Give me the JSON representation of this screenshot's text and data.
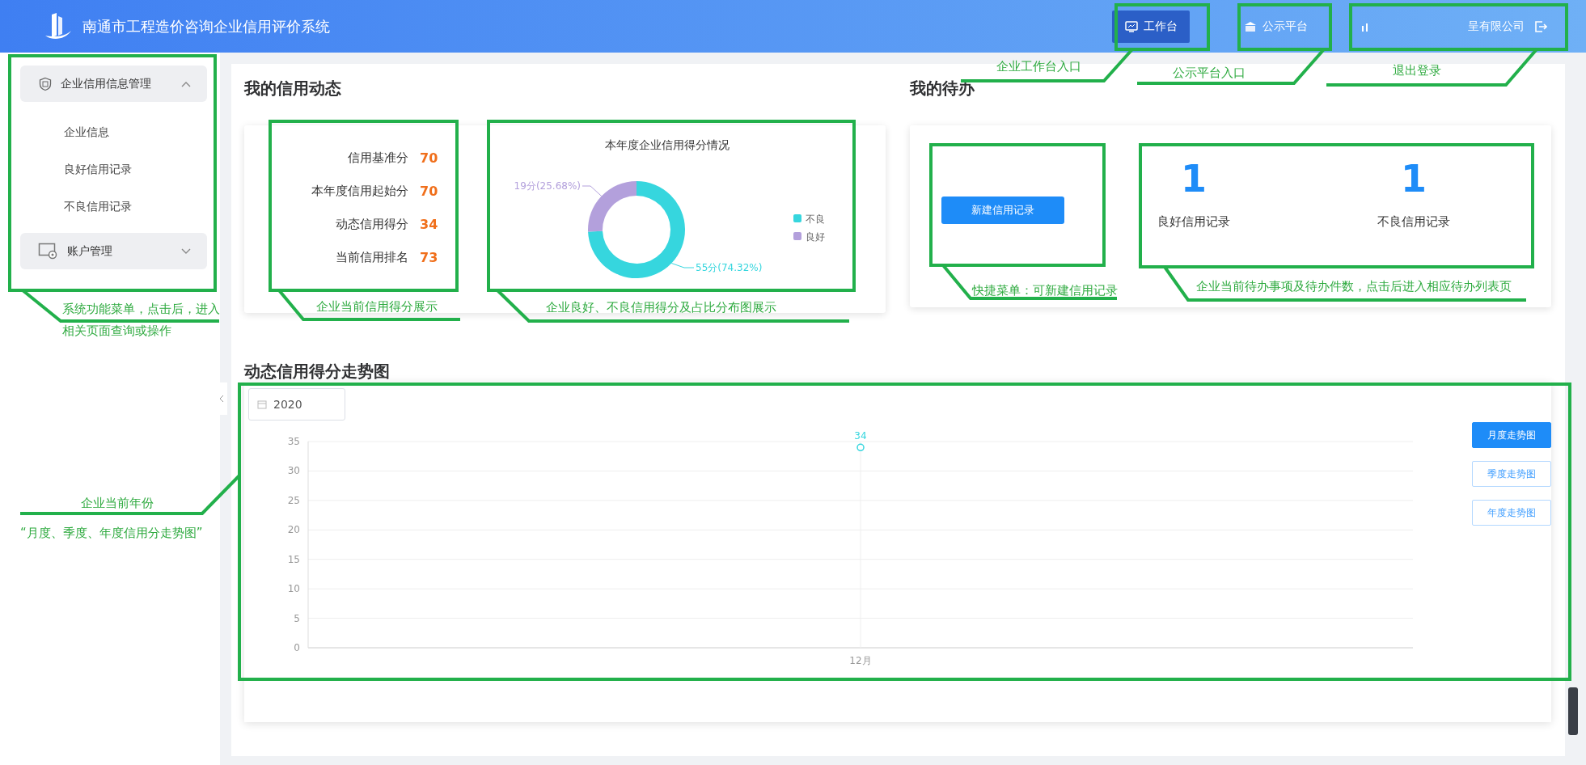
{
  "header": {
    "title": "南通市工程造价咨询企业信用评价系统",
    "nav": [
      {
        "label": "工作台",
        "selected": true
      },
      {
        "label": "公示平台",
        "selected": false
      }
    ],
    "user": {
      "name": "呈有限公司"
    }
  },
  "sidebar": {
    "groups": [
      {
        "label": "企业信用信息管理",
        "expanded": true,
        "items": [
          "企业信息",
          "良好信用记录",
          "不良信用记录"
        ]
      },
      {
        "label": "账户管理",
        "expanded": false
      }
    ]
  },
  "credit": {
    "title": "我的信用动态",
    "scores": [
      {
        "label": "信用基准分",
        "value": "70"
      },
      {
        "label": "本年度信用起始分",
        "value": "70"
      },
      {
        "label": "动态信用得分",
        "value": "34"
      },
      {
        "label": "当前信用排名",
        "value": "73"
      }
    ],
    "pie": {
      "chart_data": {
        "type": "donut",
        "title": "本年度企业信用得分情况",
        "categories": [
          "不良",
          "良好"
        ],
        "values": [
          55,
          19
        ],
        "colors": [
          "#36d6de",
          "#b3a0dc"
        ],
        "value_labels": [
          "55分(74.32%)",
          "19分(25.68%)"
        ],
        "legend": true
      }
    }
  },
  "todo": {
    "title": "我的待办",
    "action": "新建信用记录",
    "counts": [
      {
        "value": "1",
        "label": "良好信用记录"
      },
      {
        "value": "1",
        "label": "不良信用记录"
      }
    ]
  },
  "trend": {
    "title": "动态信用得分走势图",
    "year": "2020",
    "chart_data": {
      "type": "line",
      "categories": [
        "12月"
      ],
      "series": [
        {
          "color": "#36d6de",
          "values": [
            34
          ],
          "marker": "circle"
        }
      ],
      "grid": true,
      "ylim": [
        0,
        35
      ],
      "yticks": [
        0,
        5,
        10,
        15,
        20,
        25,
        30,
        35
      ],
      "data_labels": true
    },
    "modes": [
      {
        "label": "月度走势图",
        "selected": true
      },
      {
        "label": "季度走势图",
        "selected": false
      },
      {
        "label": "年度走势图",
        "selected": false
      }
    ]
  },
  "annotations": [
    "企业工作台入口",
    "公示平台入口",
    "退出登录",
    "系统功能菜单，点击后，进入",
    "相关页面查询或操作",
    "企业当前信用得分展示",
    "企业良好、不良信用得分及占比分布图展示",
    "快捷菜单：可新建信用记录",
    "企业当前待办事项及待办件数，点击后进入相应待办列表页",
    "企业当前年份",
    "“月度、季度、年度信用分走势图”"
  ]
}
